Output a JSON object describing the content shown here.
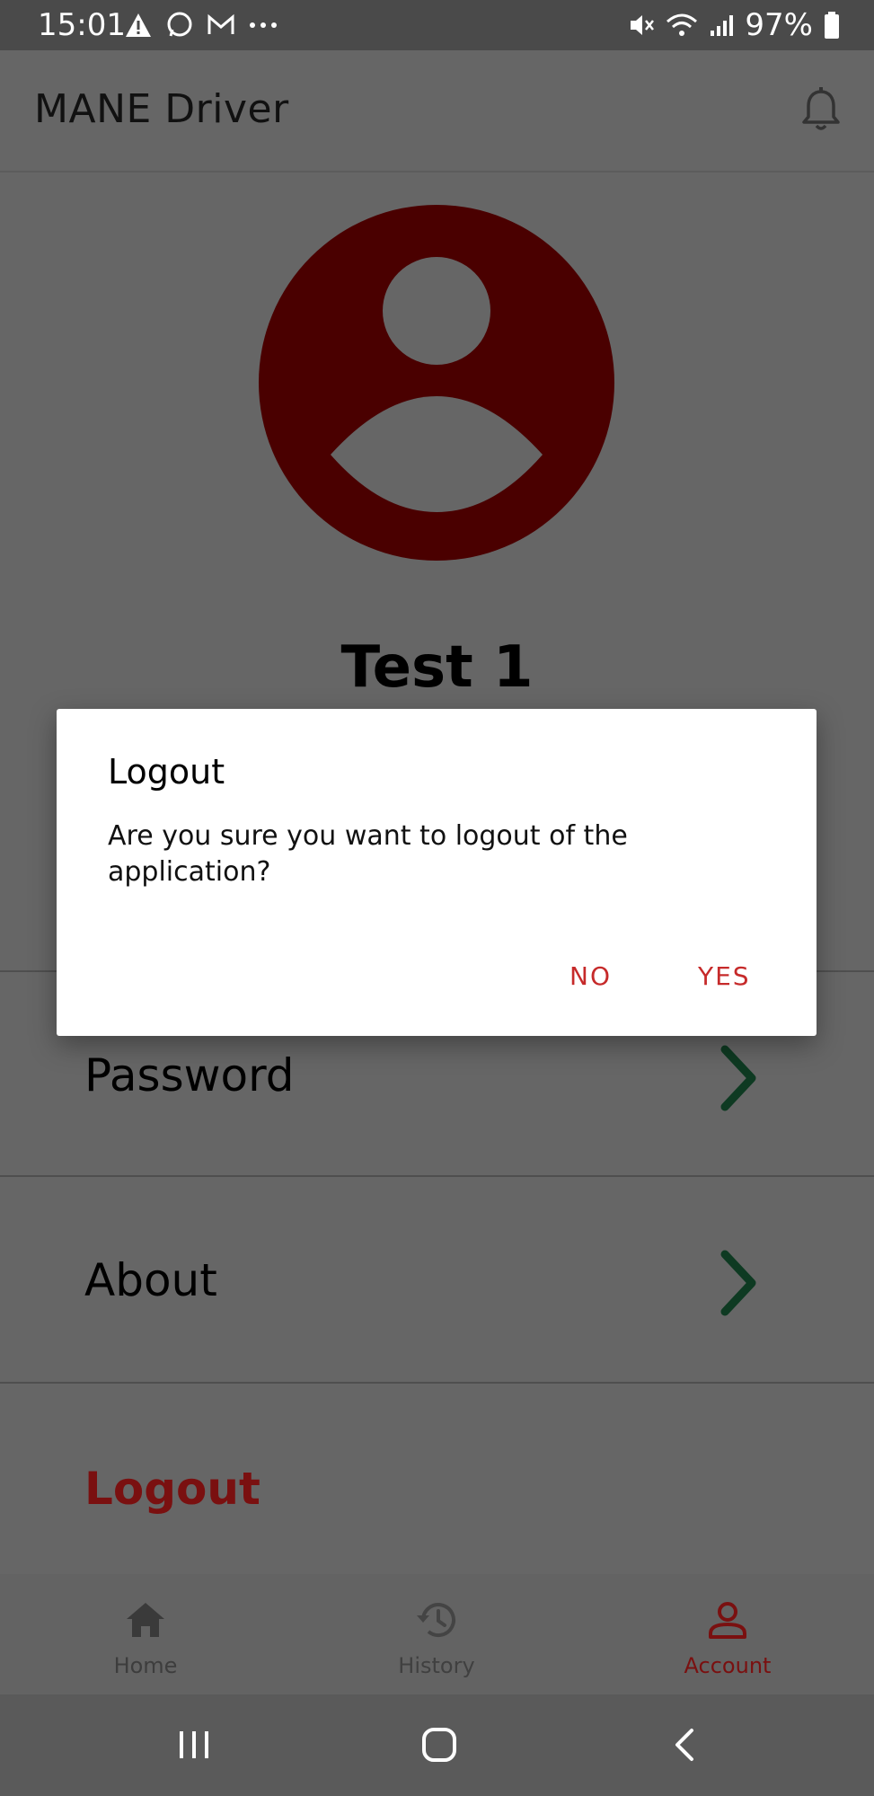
{
  "status_bar": {
    "time": "15:01",
    "battery_percent": "97%"
  },
  "app_bar": {
    "title": "MANE Driver"
  },
  "profile": {
    "name": "Test 1"
  },
  "menu": {
    "items": [
      {
        "label": "Password"
      },
      {
        "label": "About"
      }
    ],
    "logout_label": "Logout"
  },
  "bottom_nav": {
    "tabs": [
      {
        "label": "Home",
        "icon": "home-icon"
      },
      {
        "label": "History",
        "icon": "history-icon"
      },
      {
        "label": "Account",
        "icon": "account-icon",
        "active": true
      }
    ]
  },
  "dialog": {
    "title": "Logout",
    "message": "Are you sure you want to logout of the application?",
    "no_label": "NO",
    "yes_label": "YES"
  },
  "colors": {
    "accent": "#c62a2a",
    "avatar_bg": "#4a0000",
    "chevron": "#0e3a22",
    "logout_text": "#7a1010"
  }
}
